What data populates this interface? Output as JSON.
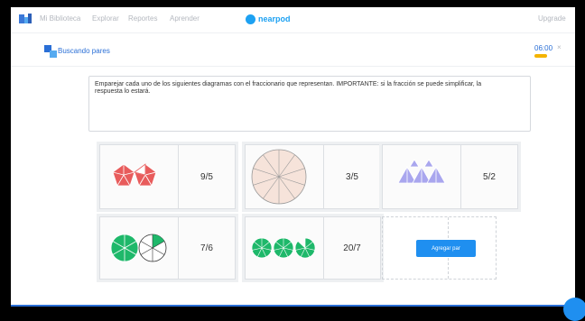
{
  "topbar": {
    "nav": [
      "Mi Biblioteca",
      "Explorar",
      "Reportes",
      "Aprender"
    ],
    "brand": "nearpod",
    "upgrade": "Upgrade"
  },
  "activity": {
    "title": "Buscando pares",
    "timer": "06:00",
    "close": "×"
  },
  "instructions": "Emparejar cada uno de los siguientes diagramas con el fraccionario que representan. IMPORTANTE: si la fracción se puede simplificar, la respuesta lo estará.",
  "cards": [
    {
      "label": "9/5",
      "diagram": "red pentagons"
    },
    {
      "label": "3/5",
      "diagram": "circle divided in 10"
    },
    {
      "label": "5/2",
      "diagram": "purple triangles"
    },
    {
      "label": "7/6",
      "diagram": "green circles divided in 6"
    },
    {
      "label": "20/7",
      "diagram": "green circles divided in 7"
    }
  ],
  "add_pair_button": "Agregar par",
  "colors": {
    "accent": "#1f8ff0",
    "red": "#e85c5c",
    "green": "#1eb86a",
    "purple": "#a9a6ee",
    "timer": "#f4b400"
  }
}
